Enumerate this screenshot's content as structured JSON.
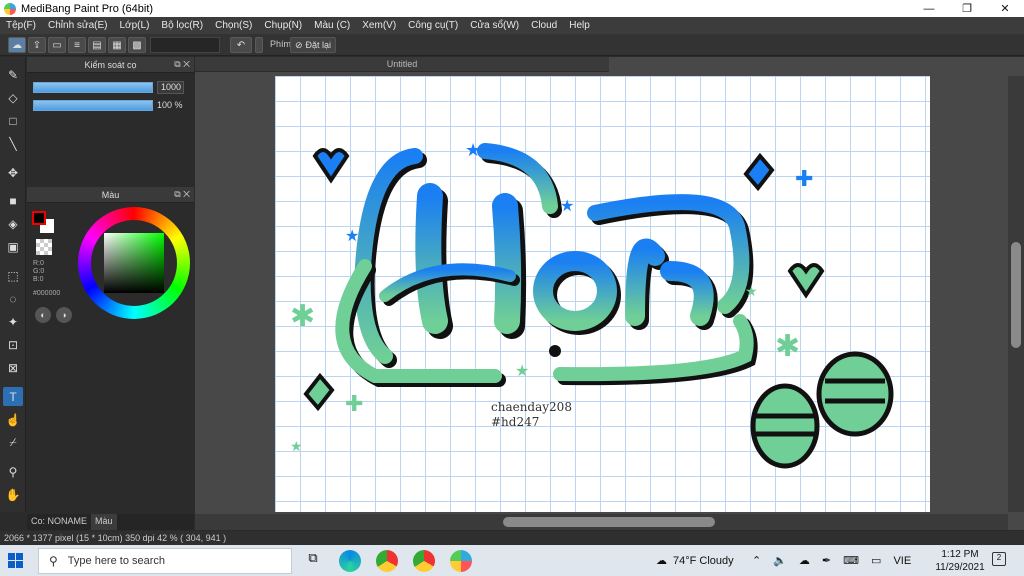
{
  "window": {
    "title": "MediBang Paint Pro (64bit)",
    "controls": [
      "—",
      "❐",
      "✕"
    ]
  },
  "menu": [
    "Tệp(F)",
    "Chỉnh sửa(E)",
    "Lớp(L)",
    "Bộ lọc(R)",
    "Chọn(S)",
    "Chụp(N)",
    "Màu (C)",
    "Xem(V)",
    "Công cụ(T)",
    "Cửa sổ(W)",
    "Cloud",
    "Help"
  ],
  "toolbar": {
    "shortcut_label": "Phím",
    "reset_label": "Đặt lại"
  },
  "brush_panel": {
    "title": "Kiểm soát cọ",
    "size_value": "1000",
    "opacity_value": "100 %"
  },
  "color_panel": {
    "title": "Màu",
    "r": "R:0",
    "g": "G:0",
    "b": "B:0",
    "hex": "#000000",
    "fg": "#000000",
    "bg": "#ffffff"
  },
  "bottom_tabs": [
    "Co: NONAME",
    "Màu"
  ],
  "document": {
    "tab": "Untitled"
  },
  "canvas_art": {
    "word": "Hạt",
    "signature": "chaenday208",
    "hashtag": "#hd247",
    "gradient_top": "#1a7ff2",
    "gradient_bottom": "#6fcf97"
  },
  "status": {
    "text": "2066 * 1377 pixel   (15 * 10cm)   350 dpi   42 %   ( 304, 941 )"
  },
  "taskbar": {
    "search_placeholder": "Type here to search",
    "weather": "74°F  Cloudy",
    "lang": "VIE",
    "time": "1:12 PM",
    "date": "11/29/2021",
    "notifications": "2"
  }
}
